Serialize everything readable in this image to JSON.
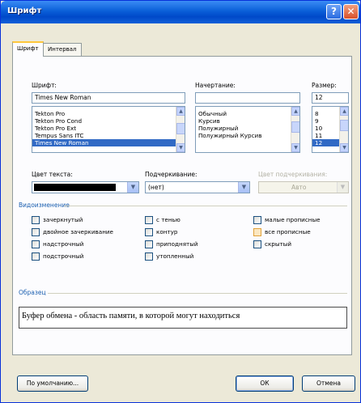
{
  "window": {
    "title": "Шрифт",
    "help_label": "?",
    "close_label": "✕"
  },
  "tabs": [
    {
      "label": "Шрифт",
      "active": true
    },
    {
      "label": "Интервал",
      "active": false
    }
  ],
  "font": {
    "label": "Шрифт:",
    "value": "Times New Roman",
    "items": [
      "Tekton Pro",
      "Tekton Pro Cond",
      "Tekton Pro Ext",
      "Tempus Sans ITC",
      "Times New Roman"
    ],
    "selected": "Times New Roman"
  },
  "style": {
    "label": "Начертание:",
    "value": "",
    "items": [
      "Обычный",
      "Курсив",
      "Полужирный",
      "Полужирный Курсив"
    ]
  },
  "size": {
    "label": "Размер:",
    "value": "12",
    "items": [
      "8",
      "9",
      "10",
      "11",
      "12"
    ],
    "selected": "12"
  },
  "text_color": {
    "label": "Цвет текста:",
    "swatch": "#000000"
  },
  "underline": {
    "label": "Подчеркивание:",
    "value": "(нет)"
  },
  "underline_color": {
    "label": "Цвет подчеркивания:",
    "value": "Авто",
    "enabled": false
  },
  "effects": {
    "title": "Видоизменение",
    "items": [
      {
        "label": "зачеркнутый",
        "checked": false
      },
      {
        "label": "двойное зачеркивание",
        "checked": false
      },
      {
        "label": "надстрочный",
        "checked": false
      },
      {
        "label": "подстрочный",
        "checked": false
      },
      {
        "label": "с тенью",
        "checked": false
      },
      {
        "label": "контур",
        "checked": false
      },
      {
        "label": "приподнятый",
        "checked": false
      },
      {
        "label": "утопленный",
        "checked": false
      },
      {
        "label": "малые прописные",
        "checked": false
      },
      {
        "label": "все прописные",
        "checked": false
      },
      {
        "label": "скрытый",
        "checked": false
      }
    ]
  },
  "preview": {
    "title": "Образец",
    "text": "Буфер обмена - область памяти, в которой могут находиться"
  },
  "buttons": {
    "default": "По умолчанию...",
    "ok": "ОК",
    "cancel": "Отмена"
  },
  "colors": {
    "titlebar": "#0a5fd8",
    "selection": "#316ac5",
    "group_title": "#1b5fb0"
  }
}
